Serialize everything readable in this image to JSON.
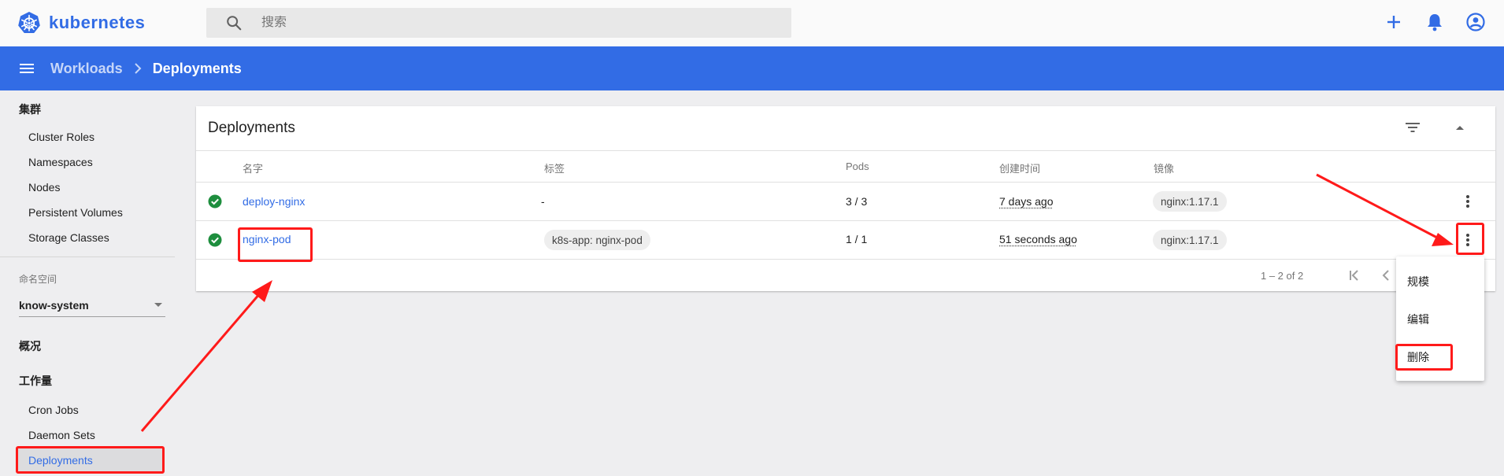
{
  "brand": {
    "name": "kubernetes",
    "color": "#326ce5"
  },
  "search": {
    "placeholder": "搜索"
  },
  "top_actions": {
    "icons": [
      "add-icon",
      "bell-icon",
      "account-circle-icon"
    ]
  },
  "breadcrumb": {
    "parent": "Workloads",
    "current": "Deployments"
  },
  "sidebar": {
    "cluster_heading": "集群",
    "cluster_items": [
      "Cluster Roles",
      "Namespaces",
      "Nodes",
      "Persistent Volumes",
      "Storage Classes"
    ],
    "namespace_label": "命名空间",
    "namespace_value": "know-system",
    "overview": "概况",
    "workloads_heading": "工作量",
    "workload_items": [
      "Cron Jobs",
      "Daemon Sets",
      "Deployments"
    ],
    "active_item": "Deployments"
  },
  "card": {
    "title": "Deployments",
    "columns": [
      "名字",
      "标签",
      "Pods",
      "创建时间",
      "镜像"
    ],
    "rows": [
      {
        "status": "running",
        "name": "deploy-nginx",
        "labels": "-",
        "pods": "3 / 3",
        "created": "7 days ago",
        "image": "nginx:1.17.1"
      },
      {
        "status": "running",
        "name": "nginx-pod",
        "labels": "k8s-app: nginx-pod",
        "pods": "1 / 1",
        "created": "51 seconds ago",
        "image": "nginx:1.17.1"
      }
    ],
    "pagination": "1 – 2 of 2"
  },
  "row_menu": {
    "items": [
      "规模",
      "编辑",
      "删除"
    ]
  },
  "annotation_color": "#ff1a1a",
  "status_color": "#1e8e3e"
}
